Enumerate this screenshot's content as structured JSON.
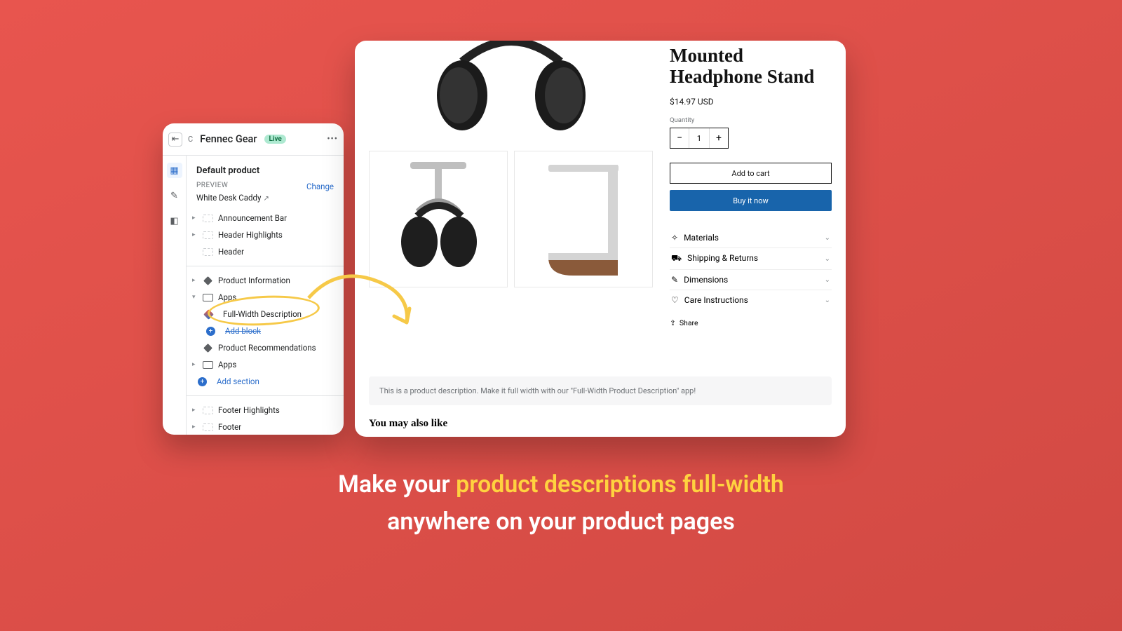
{
  "editor": {
    "crumb": "C",
    "store_name": "Fennec Gear",
    "live_badge": "Live",
    "template_heading": "Default product",
    "preview_label": "PREVIEW",
    "change_link": "Change",
    "preview_product": "White Desk Caddy",
    "sections": {
      "announcement": "Announcement Bar",
      "header_highlights": "Header Highlights",
      "header": "Header",
      "product_info": "Product Information",
      "apps_group": "Apps",
      "full_width_block": "Full-Width Description",
      "add_block": "Add block",
      "recommendations": "Product Recommendations",
      "apps2": "Apps",
      "add_section": "Add section",
      "footer_highlights": "Footer Highlights",
      "footer": "Footer"
    }
  },
  "product": {
    "title": "Mounted Headphone Stand",
    "price": "$14.97 USD",
    "qty_label": "Quantity",
    "qty_value": "1",
    "add_to_cart": "Add to cart",
    "buy_now": "Buy it now",
    "accordions": {
      "materials": "Materials",
      "shipping": "Shipping & Returns",
      "dimensions": "Dimensions",
      "care": "Care Instructions"
    },
    "share": "Share",
    "description_band": "This is a product description. Make it full width with our \"Full-Width Product Description\" app!",
    "you_may_also_like": "You may also like"
  },
  "caption": {
    "line1a": "Make your ",
    "line1b": "product descriptions full-width",
    "line2": "anywhere on your product pages"
  }
}
